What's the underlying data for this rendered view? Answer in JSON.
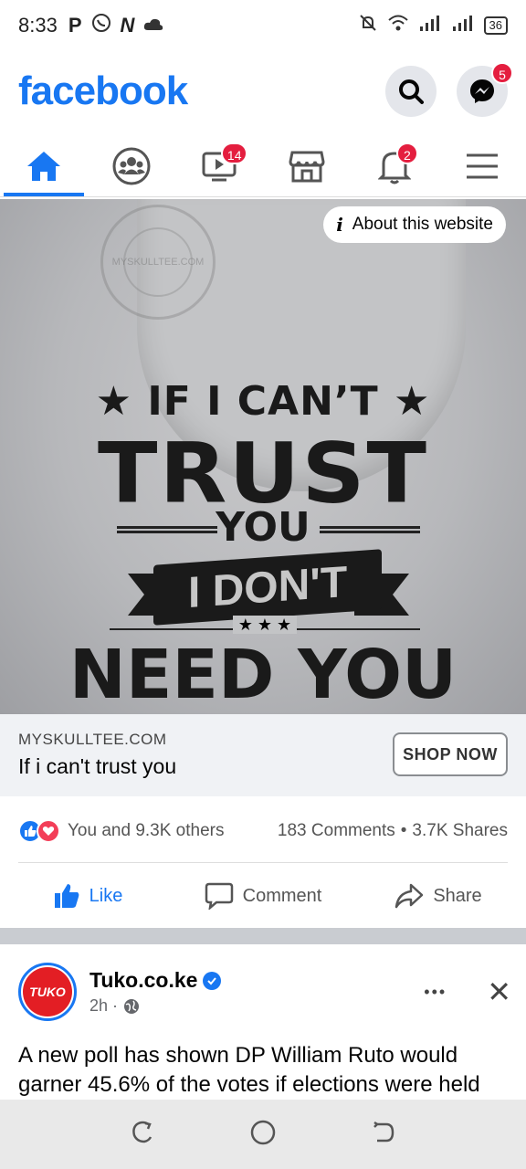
{
  "status_bar": {
    "time": "8:33",
    "left_icons": [
      "P",
      "whatsapp-icon",
      "N",
      "cloud-icon"
    ],
    "battery": "36",
    "right_icons": [
      "mute-icon",
      "wifi-icon",
      "signal-icon",
      "signal-icon",
      "battery-icon"
    ]
  },
  "header": {
    "logo": "facebook",
    "messenger_badge": "5"
  },
  "tabs": [
    {
      "name": "home",
      "icon": "home-icon",
      "badge": ""
    },
    {
      "name": "groups",
      "icon": "groups-icon",
      "badge": ""
    },
    {
      "name": "watch",
      "icon": "video-icon",
      "badge": "14"
    },
    {
      "name": "marketplace",
      "icon": "store-icon",
      "badge": ""
    },
    {
      "name": "notifications",
      "icon": "bell-icon",
      "badge": "2"
    },
    {
      "name": "menu",
      "icon": "hamburger-icon",
      "badge": ""
    }
  ],
  "ad": {
    "about_label": "About this website",
    "image_lines": [
      "★ IF I CAN’T ★",
      "TRUST",
      "YOU",
      "I DON'T",
      "★ ★ ★",
      "NEED YOU"
    ],
    "seal_text": "MYSKULLTEE.COM",
    "domain": "MYSKULLTEE.COM",
    "title": "If i can't trust you",
    "cta": "SHOP NOW"
  },
  "engagement": {
    "reactions_text": "You and 9.3K others",
    "comments": "183 Comments",
    "dot": "•",
    "shares": "3.7K Shares"
  },
  "actions": {
    "like": "Like",
    "comment": "Comment",
    "share": "Share"
  },
  "post": {
    "avatar_text": "TUKO",
    "author": "Tuko.co.ke",
    "time": "2h ·",
    "more": "•••",
    "close": "✕",
    "text": "A new poll has shown DP William Ruto would garner 45.6% of the votes if elections were held"
  },
  "colors": {
    "brand": "#1877f2",
    "badge": "#e41e3f",
    "love": "#f33e58"
  }
}
